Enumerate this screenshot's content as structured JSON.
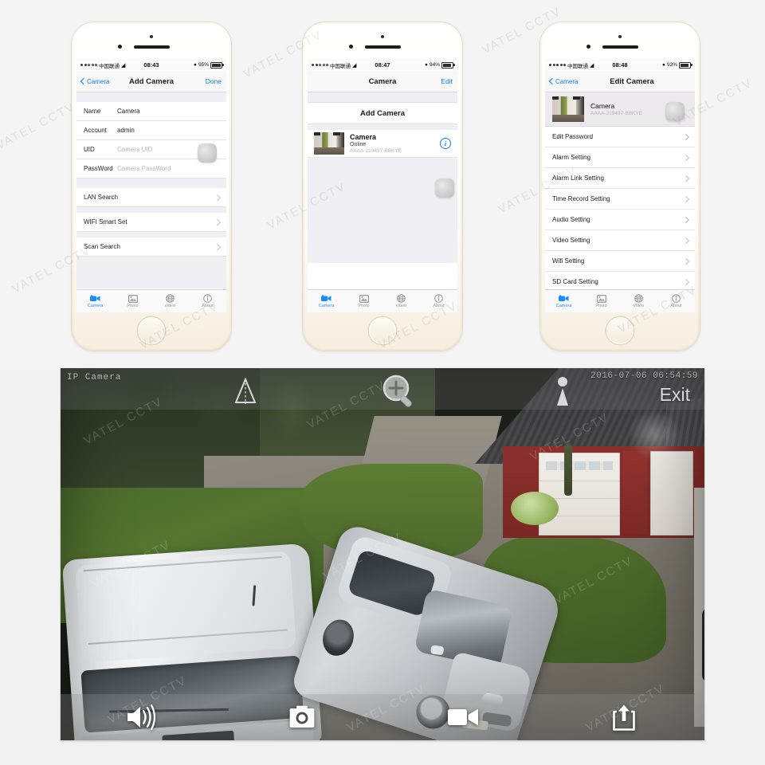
{
  "page": {
    "background": "#f2f2f2",
    "watermark": "VATEL CCTV",
    "accent_blue": "#0a7dfd"
  },
  "phones": [
    {
      "id": "add-camera",
      "status_bar": {
        "carrier": "中国联通",
        "time": "08:43",
        "battery": "95%"
      },
      "navbar": {
        "back_label": "Camera",
        "title": "Add Camera",
        "right_label": "Done"
      },
      "fields": [
        {
          "label": "Name",
          "value": "Camera",
          "is_placeholder": false
        },
        {
          "label": "Account",
          "value": "admin",
          "is_placeholder": false
        },
        {
          "label": "UID",
          "value": "Camera UID",
          "is_placeholder": true
        },
        {
          "label": "PassWord",
          "value": "Camera PassWord",
          "is_placeholder": true
        }
      ],
      "actions": [
        {
          "label": "LAN Search"
        },
        {
          "label": "WIFI Smart Set"
        },
        {
          "label": "Scan Search"
        }
      ]
    },
    {
      "id": "camera-list",
      "status_bar": {
        "carrier": "中国联通",
        "time": "08:47",
        "battery": "94%"
      },
      "navbar": {
        "title": "Camera",
        "right_label": "Edit"
      },
      "add_camera_label": "Add Camera",
      "camera": {
        "name": "Camera",
        "status": "Online",
        "uid": "AAAA-219497-BBKYE",
        "info_icon": "info-icon"
      }
    },
    {
      "id": "edit-camera",
      "status_bar": {
        "carrier": "中国联通",
        "time": "08:48",
        "battery": "93%"
      },
      "navbar": {
        "back_label": "Camera",
        "title": "Edit Camera"
      },
      "camera": {
        "name": "Camera",
        "uid": "AAAA-219497-BBKYE"
      },
      "settings": [
        {
          "label": "Edit Password"
        },
        {
          "label": "Alarm Setting"
        },
        {
          "label": "Alarm Link Setting"
        },
        {
          "label": "Time Record Setting"
        },
        {
          "label": "Audio Setting"
        },
        {
          "label": "Video Setting"
        },
        {
          "label": "Wifi Setting"
        },
        {
          "label": "SD Card Setting"
        }
      ]
    }
  ],
  "tabbar": {
    "items": [
      {
        "label": "Camera",
        "icon": "camcorder-icon",
        "active": true
      },
      {
        "label": "Photo",
        "icon": "photo-icon",
        "active": false
      },
      {
        "label": "video",
        "icon": "globe-icon",
        "active": false
      },
      {
        "label": "About",
        "icon": "info-icon",
        "active": false
      }
    ]
  },
  "viewer": {
    "label": "IP Camera",
    "timestamp": "2016-07-06 06:54:59",
    "exit_label": "Exit",
    "top_icons": [
      {
        "name": "cone-icon"
      },
      {
        "name": "zoom-in-icon"
      },
      {
        "name": "person-icon"
      }
    ],
    "bottom_icons": [
      {
        "name": "speaker-icon"
      },
      {
        "name": "snapshot-camera-icon"
      },
      {
        "name": "record-video-icon"
      },
      {
        "name": "share-icon"
      }
    ]
  }
}
